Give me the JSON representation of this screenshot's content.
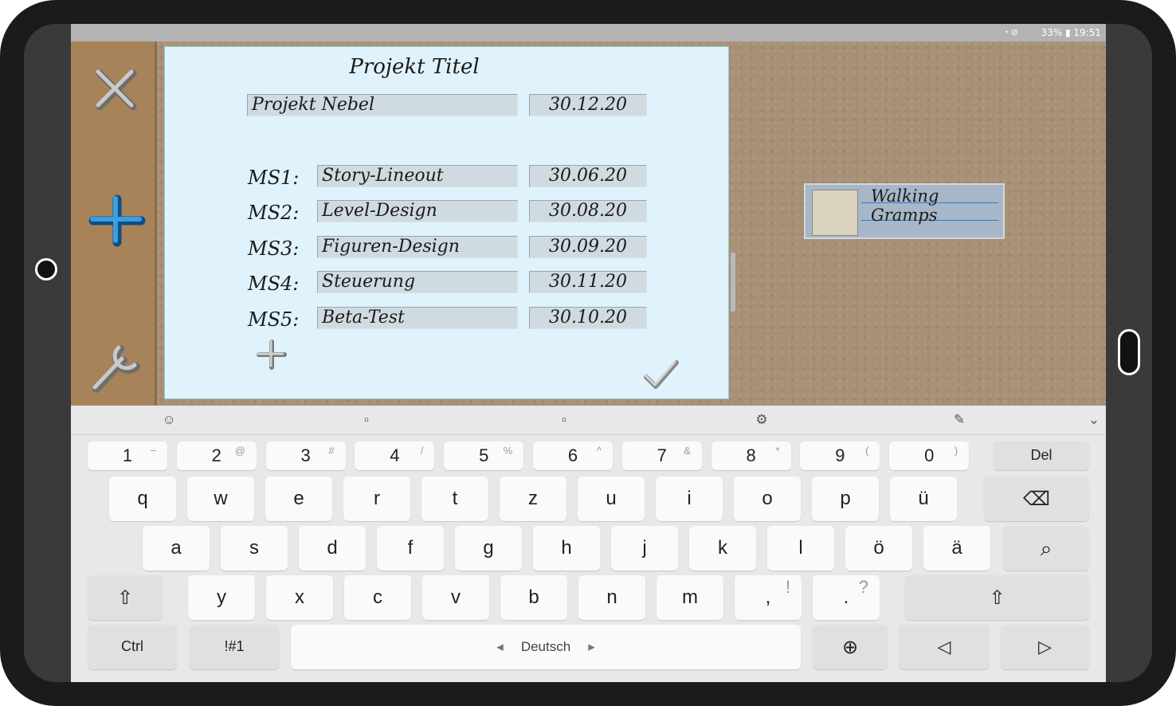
{
  "status": {
    "battery": "33%",
    "time": "19:51"
  },
  "sidebar": {
    "close_icon": "close-icon",
    "add_icon": "plus-icon",
    "settings_icon": "wrench-icon"
  },
  "dialog": {
    "title": "Projekt Titel",
    "project_name": "Projekt Nebel",
    "project_date": "30.12.20",
    "milestones": [
      {
        "label": "MS1:",
        "name": "Story-Lineout",
        "date": "30.06.20"
      },
      {
        "label": "MS2:",
        "name": "Level-Design",
        "date": "30.08.20"
      },
      {
        "label": "MS3:",
        "name": "Figuren-Design",
        "date": "30.09.20"
      },
      {
        "label": "MS4:",
        "name": "Steuerung",
        "date": "30.11.20"
      },
      {
        "label": "MS5:",
        "name": "Beta-Test",
        "date": "30.10.20"
      }
    ]
  },
  "note": {
    "line1": "Walking",
    "line2": "Gramps"
  },
  "keyboard": {
    "toolbar": [
      "emoji-icon",
      "sticker-icon",
      "gif-icon",
      "gear-icon",
      "handwriting-icon",
      "chevron-down-icon"
    ],
    "row_numbers": [
      {
        "main": "1",
        "sub": "−"
      },
      {
        "main": "2",
        "sub": "@"
      },
      {
        "main": "3",
        "sub": "#"
      },
      {
        "main": "4",
        "sub": "/"
      },
      {
        "main": "5",
        "sub": "%"
      },
      {
        "main": "6",
        "sub": "^"
      },
      {
        "main": "7",
        "sub": "&"
      },
      {
        "main": "8",
        "sub": "*"
      },
      {
        "main": "9",
        "sub": "("
      },
      {
        "main": "0",
        "sub": ")"
      }
    ],
    "del": "Del",
    "row1": [
      "q",
      "w",
      "e",
      "r",
      "t",
      "z",
      "u",
      "i",
      "o",
      "p",
      "ü"
    ],
    "row2": [
      "a",
      "s",
      "d",
      "f",
      "g",
      "h",
      "j",
      "k",
      "l",
      "ö",
      "ä"
    ],
    "row3": [
      "y",
      "x",
      "c",
      "v",
      "b",
      "n",
      "m"
    ],
    "comma": ",",
    "comma_sub": "!",
    "period": ".",
    "period_sub": "?",
    "ctrl": "Ctrl",
    "symbols": "!#1",
    "space": "Deutsch",
    "space_left": "◂",
    "space_right": "▸"
  }
}
